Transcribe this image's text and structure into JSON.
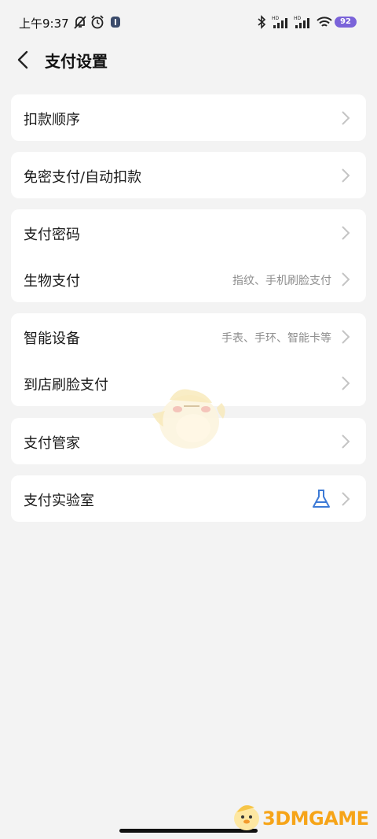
{
  "status_bar": {
    "time": "上午9:37",
    "battery": "92",
    "icons": [
      "mute-bell-icon",
      "alarm-clock-icon",
      "app-badge-icon",
      "bluetooth-icon",
      "hd-signal-icon",
      "hd-signal-icon",
      "wifi-icon",
      "battery-icon"
    ]
  },
  "header": {
    "title": "支付设置",
    "back_icon": "chevron-left-icon"
  },
  "groups": [
    {
      "rows": [
        {
          "label": "扣款顺序",
          "sub": ""
        }
      ]
    },
    {
      "rows": [
        {
          "label": "免密支付/自动扣款",
          "sub": ""
        }
      ]
    },
    {
      "rows": [
        {
          "label": "支付密码",
          "sub": ""
        },
        {
          "label": "生物支付",
          "sub": "指纹、手机刷脸支付"
        }
      ]
    },
    {
      "rows": [
        {
          "label": "智能设备",
          "sub": "手表、手环、智能卡等"
        },
        {
          "label": "到店刷脸支付",
          "sub": ""
        }
      ]
    },
    {
      "rows": [
        {
          "label": "支付管家",
          "sub": ""
        }
      ]
    },
    {
      "rows": [
        {
          "label": "支付实验室",
          "sub": "",
          "icon": "flask-icon"
        }
      ]
    }
  ],
  "watermark": {
    "text": "3DMGAME"
  },
  "colors": {
    "background": "#f3f3f3",
    "card": "#ffffff",
    "accent": "#3d7ad6",
    "chevron": "#c4c4c4",
    "subtext": "#8e8e8e"
  }
}
